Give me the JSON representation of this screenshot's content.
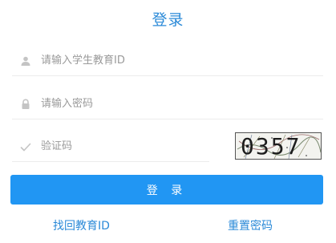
{
  "form": {
    "title": "登录",
    "student_id": {
      "placeholder": "请输入学生教育ID",
      "icon": "user-icon"
    },
    "password": {
      "placeholder": "请输入密码",
      "icon": "lock-icon"
    },
    "captcha": {
      "placeholder": "验证码",
      "icon": "check-icon",
      "image_text": "0357"
    },
    "submit_label": "登 录",
    "links": {
      "find_id": "找回教育ID",
      "reset_password": "重置密码"
    }
  },
  "colors": {
    "accent": "#2196f3",
    "link": "#2b8ad8",
    "placeholder": "#9a9a9a",
    "divider": "#ececec"
  }
}
